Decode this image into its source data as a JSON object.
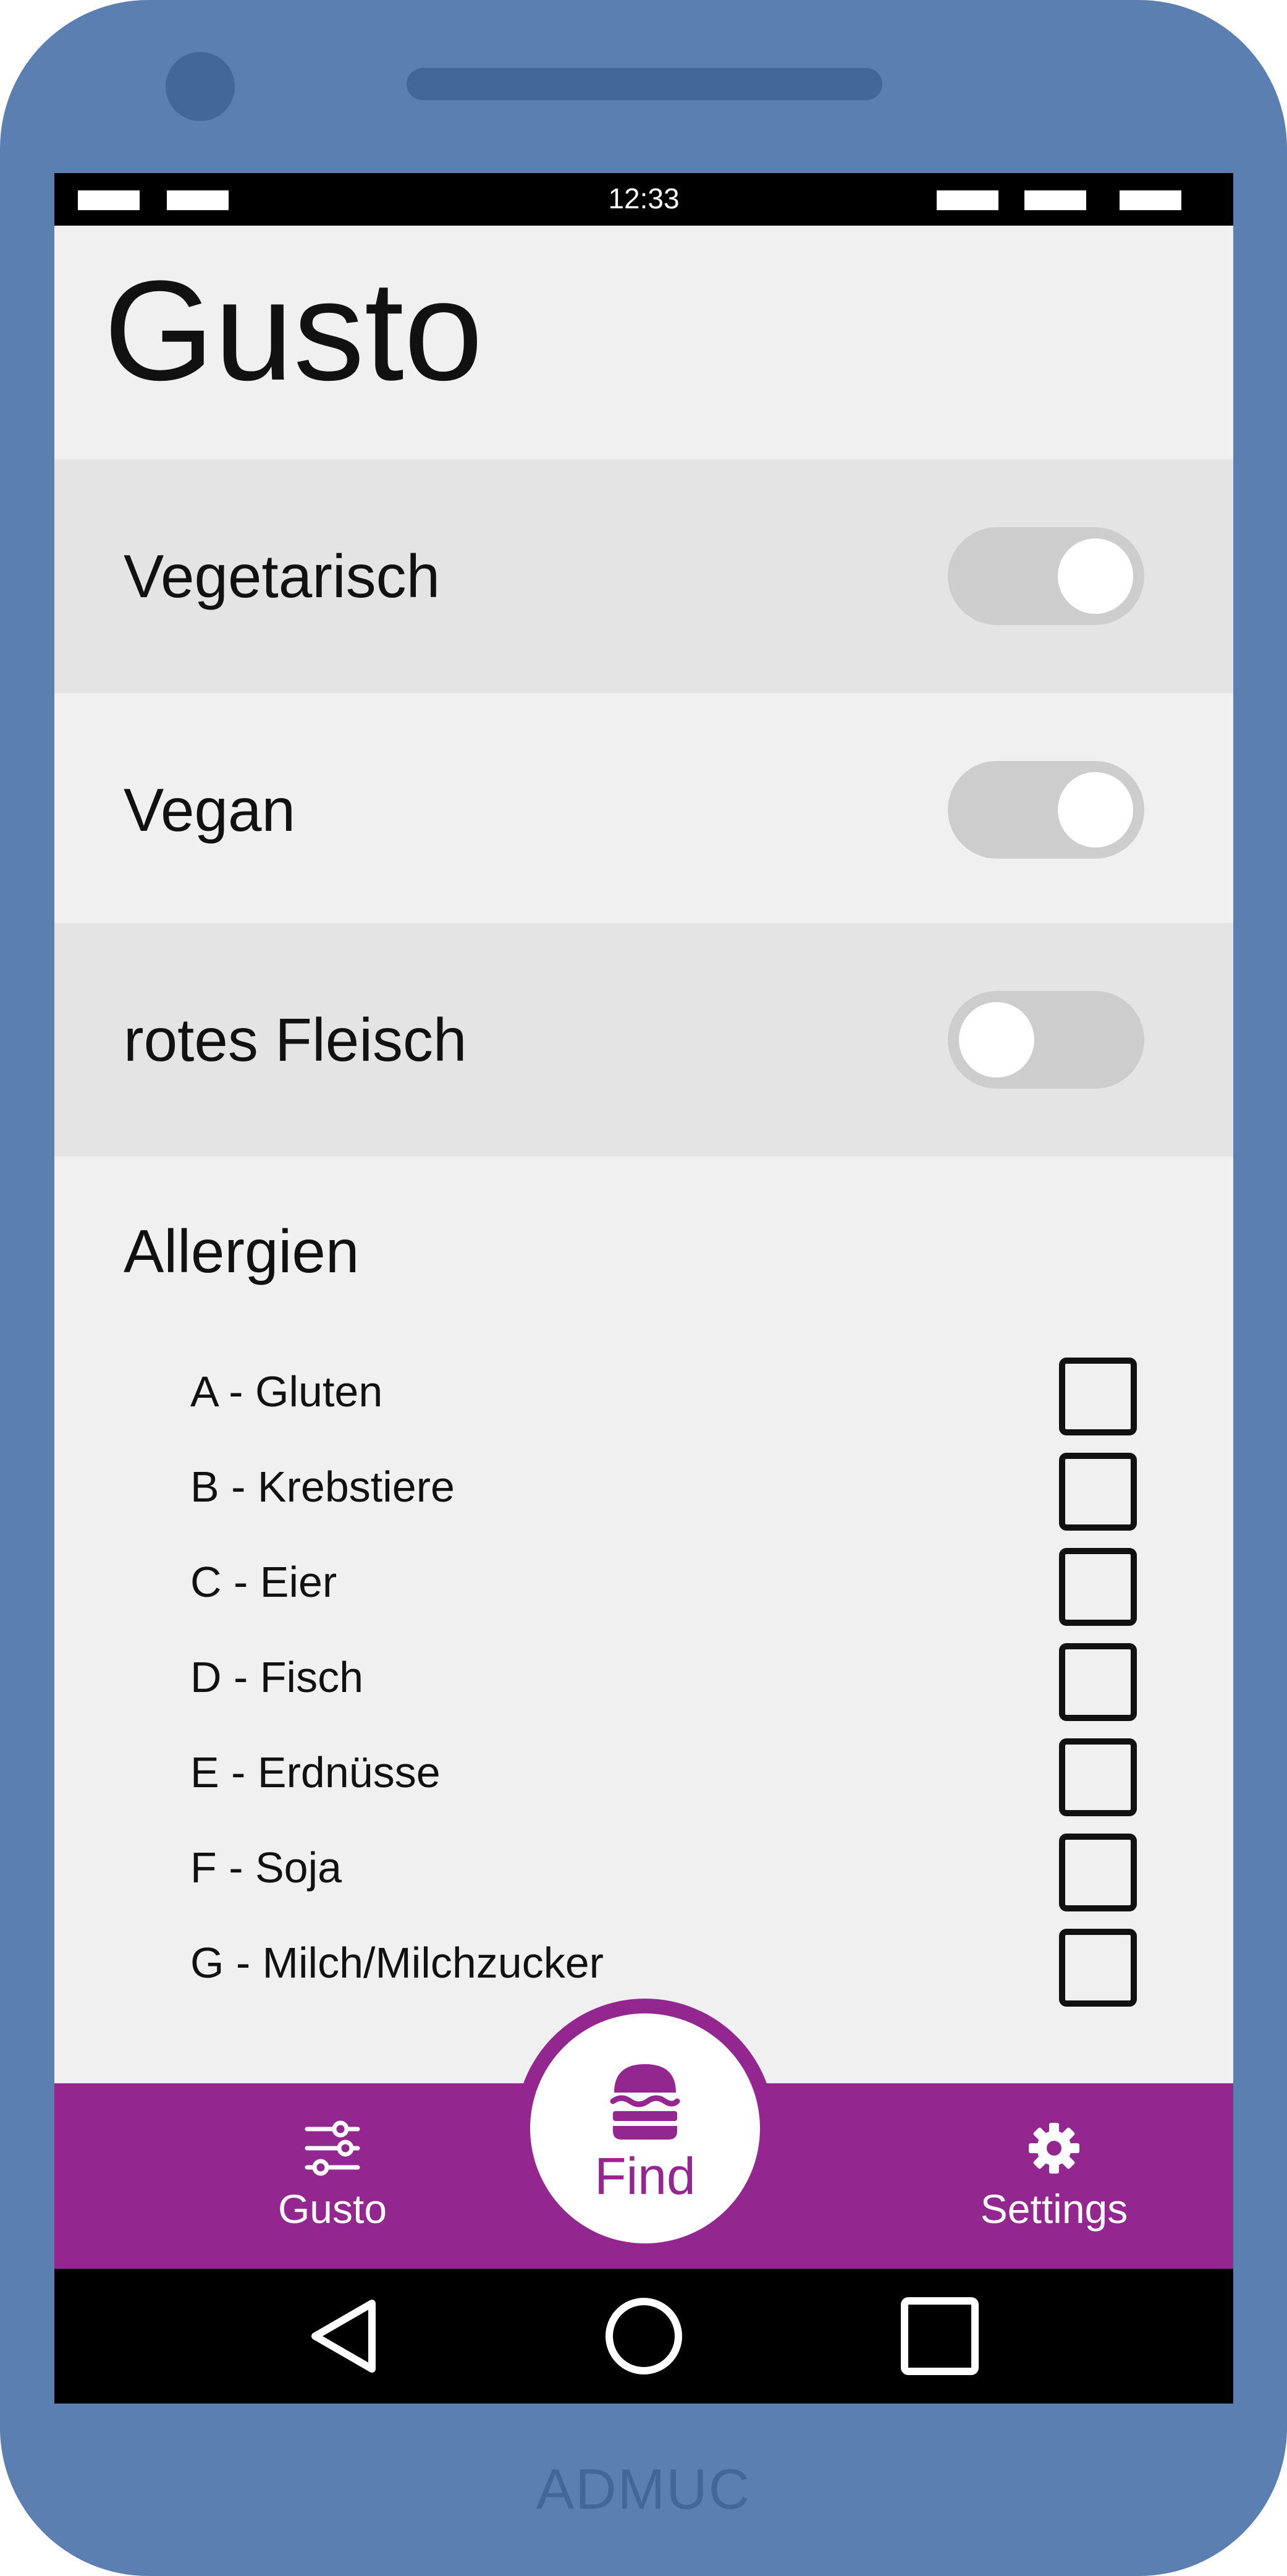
{
  "device": {
    "brand": "ADMUC",
    "frame_color": "#5b7fb1"
  },
  "status_bar": {
    "time": "12:33"
  },
  "app": {
    "title": "Gusto",
    "accent_color": "#93268f"
  },
  "preferences": [
    {
      "label": "Vegetarisch",
      "enabled": true
    },
    {
      "label": "Vegan",
      "enabled": true
    },
    {
      "label": "rotes Fleisch",
      "enabled": false
    }
  ],
  "allergies": {
    "heading": "Allergien",
    "items": [
      {
        "label": "A - Gluten",
        "checked": false
      },
      {
        "label": "B - Krebstiere",
        "checked": false
      },
      {
        "label": "C - Eier",
        "checked": false
      },
      {
        "label": "D - Fisch",
        "checked": false
      },
      {
        "label": "E - Erdnüsse",
        "checked": false
      },
      {
        "label": "F - Soja",
        "checked": false
      },
      {
        "label": "G - Milch/Milchzucker",
        "checked": false
      }
    ]
  },
  "bottom_nav": {
    "gusto": {
      "label": "Gusto",
      "icon": "sliders-icon"
    },
    "find": {
      "label": "Find",
      "icon": "burger-icon"
    },
    "settings": {
      "label": "Settings",
      "icon": "gear-icon"
    }
  },
  "system_nav": {
    "back_icon": "back-triangle-icon",
    "home_icon": "home-circle-icon",
    "recents_icon": "recents-square-icon"
  }
}
